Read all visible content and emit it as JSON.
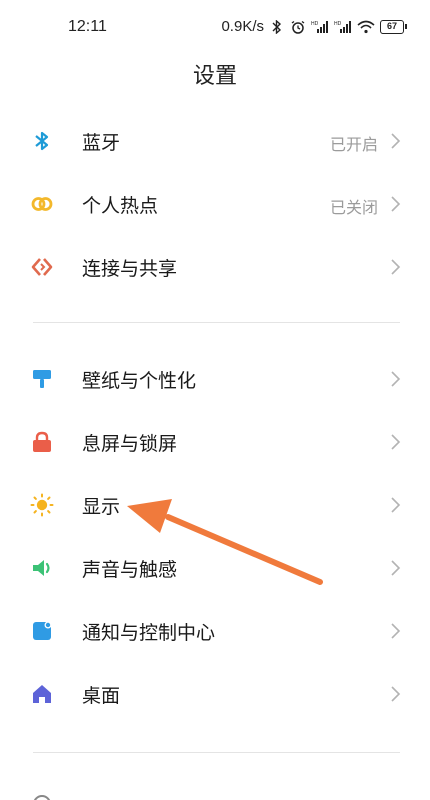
{
  "status_bar": {
    "time": "12:11",
    "network_speed": "0.9K/s",
    "battery_level": "67"
  },
  "header": {
    "title": "设置"
  },
  "sections": [
    {
      "items": [
        {
          "label": "蓝牙",
          "value": "已开启",
          "icon": "bluetooth-icon",
          "icon_color": "#1e9bd7"
        },
        {
          "label": "个人热点",
          "value": "已关闭",
          "icon": "hotspot-icon",
          "icon_color": "#f3b82b"
        },
        {
          "label": "连接与共享",
          "value": "",
          "icon": "connection-share-icon",
          "icon_color": "#e06a4e"
        }
      ]
    },
    {
      "items": [
        {
          "label": "壁纸与个性化",
          "value": "",
          "icon": "wallpaper-icon",
          "icon_color": "#2f9be4"
        },
        {
          "label": "息屏与锁屏",
          "value": "",
          "icon": "lock-icon",
          "icon_color": "#ea5e49"
        },
        {
          "label": "显示",
          "value": "",
          "icon": "sun-icon",
          "icon_color": "#f5b31f"
        },
        {
          "label": "声音与触感",
          "value": "",
          "icon": "speaker-icon",
          "icon_color": "#3cc276"
        },
        {
          "label": "通知与控制中心",
          "value": "",
          "icon": "notification-icon",
          "icon_color": "#2f9be4"
        },
        {
          "label": "桌面",
          "value": "",
          "icon": "home-icon",
          "icon_color": "#5d63d8"
        }
      ]
    }
  ],
  "annotation": {
    "arrow_color": "#f07a3c",
    "points_to": "显示"
  }
}
